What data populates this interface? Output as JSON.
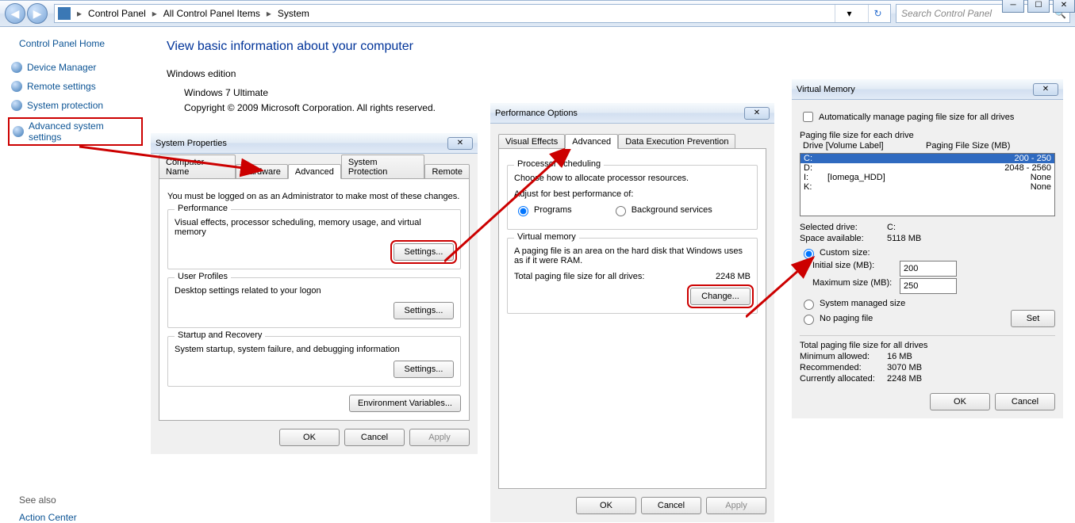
{
  "caption_buttons": {
    "min": "─",
    "max": "☐",
    "close": "✕"
  },
  "breadcrumb": {
    "items": [
      "Control Panel",
      "All Control Panel Items",
      "System"
    ]
  },
  "search_placeholder": "Search Control Panel",
  "sidebar": {
    "home": "Control Panel Home",
    "links": [
      "Device Manager",
      "Remote settings",
      "System protection",
      "Advanced system settings"
    ],
    "see_also_heading": "See also",
    "see_also_links": [
      "Action Center"
    ]
  },
  "content": {
    "page_title": "View basic information about your computer",
    "edition_heading": "Windows edition",
    "edition_name": "Windows 7 Ultimate",
    "copyright": "Copyright © 2009 Microsoft Corporation.  All rights reserved."
  },
  "sys_props": {
    "title": "System Properties",
    "tabs": [
      "Computer Name",
      "Hardware",
      "Advanced",
      "System Protection",
      "Remote"
    ],
    "active_tab": "Advanced",
    "admin_note": "You must be logged on as an Administrator to make most of these changes.",
    "performance": {
      "title": "Performance",
      "desc": "Visual effects, processor scheduling, memory usage, and virtual memory",
      "btn": "Settings..."
    },
    "user_profiles": {
      "title": "User Profiles",
      "desc": "Desktop settings related to your logon",
      "btn": "Settings..."
    },
    "startup": {
      "title": "Startup and Recovery",
      "desc": "System startup, system failure, and debugging information",
      "btn": "Settings..."
    },
    "env_btn": "Environment Variables...",
    "ok": "OK",
    "cancel": "Cancel",
    "apply": "Apply"
  },
  "perf_opts": {
    "title": "Performance Options",
    "tabs": [
      "Visual Effects",
      "Advanced",
      "Data Execution Prevention"
    ],
    "active_tab": "Advanced",
    "proc_sched": {
      "title": "Processor scheduling",
      "desc": "Choose how to allocate processor resources.",
      "adjust_label": "Adjust for best performance of:",
      "opt_programs": "Programs",
      "opt_services": "Background services"
    },
    "vm": {
      "title": "Virtual memory",
      "desc": "A paging file is an area on the hard disk that Windows uses as if it were RAM.",
      "total_label": "Total paging file size for all drives:",
      "total_value": "2248 MB",
      "btn": "Change..."
    },
    "ok": "OK",
    "cancel": "Cancel",
    "apply": "Apply"
  },
  "vmem": {
    "title": "Virtual Memory",
    "auto_label": "Automatically manage paging file size for all drives",
    "list_title": "Paging file size for each drive",
    "col_drive": "Drive  [Volume Label]",
    "col_size": "Paging File Size (MB)",
    "rows": [
      {
        "drive": "C:",
        "label": "",
        "size": "200 - 250",
        "selected": true
      },
      {
        "drive": "D:",
        "label": "",
        "size": "2048 - 2560"
      },
      {
        "drive": "I:",
        "label": "[Iomega_HDD]",
        "size": "None"
      },
      {
        "drive": "K:",
        "label": "",
        "size": "None"
      }
    ],
    "selected_drive_label": "Selected drive:",
    "selected_drive_value": "C:",
    "space_label": "Space available:",
    "space_value": "5118 MB",
    "custom_label": "Custom size:",
    "init_label": "Initial size (MB):",
    "init_value": "200",
    "max_label": "Maximum size (MB):",
    "max_value": "250",
    "sys_managed_label": "System managed size",
    "no_paging_label": "No paging file",
    "set_btn": "Set",
    "totals_heading": "Total paging file size for all drives",
    "min_label": "Minimum allowed:",
    "min_value": "16 MB",
    "rec_label": "Recommended:",
    "rec_value": "3070 MB",
    "cur_label": "Currently allocated:",
    "cur_value": "2248 MB",
    "ok": "OK",
    "cancel": "Cancel"
  }
}
